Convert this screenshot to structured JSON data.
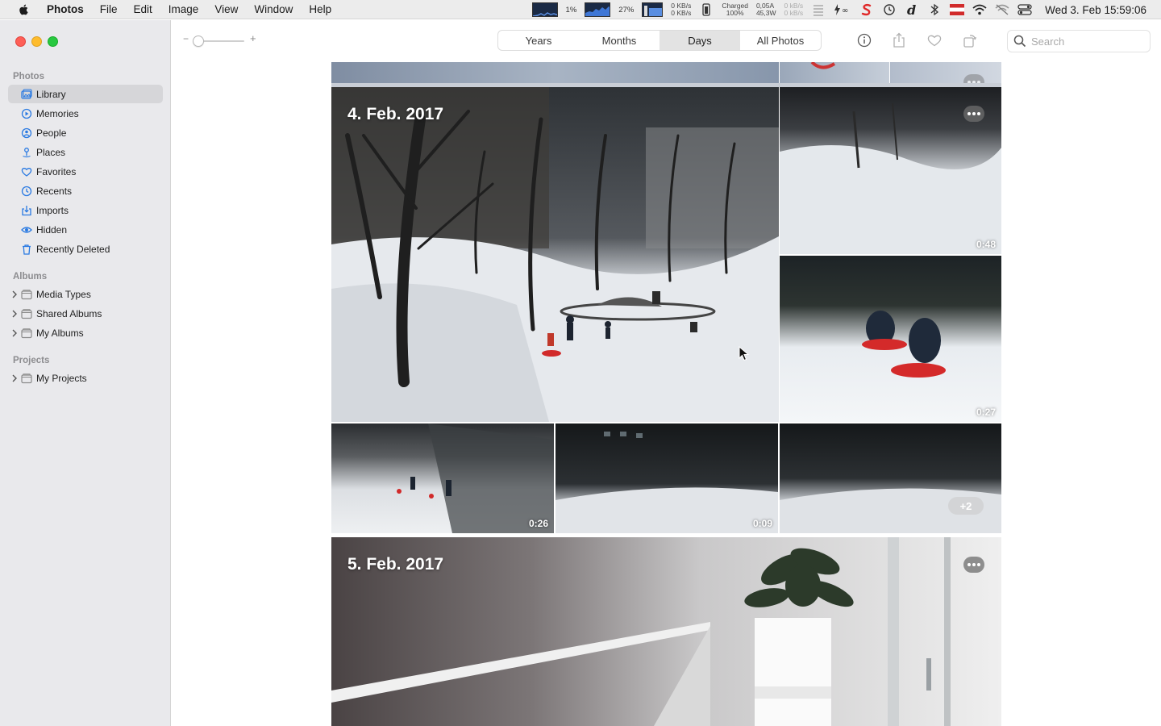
{
  "menubar": {
    "app_name": "Photos",
    "menus": [
      "File",
      "Edit",
      "Image",
      "View",
      "Window",
      "Help"
    ],
    "cpu_label": "1%",
    "gpu_label": "27%",
    "net_up": "0 KB/s",
    "net_down": "0 KB/s",
    "battery_status": "Charged",
    "battery_pct": "100%",
    "power_amp": "0,05A",
    "power_watt": "45,3W",
    "net2_up": "0 kB/s",
    "net2_down": "0 kB/s",
    "clock": "Wed 3. Feb  15:59:06"
  },
  "sidebar": {
    "section_photos": "Photos",
    "items": [
      {
        "label": "Library",
        "icon": "library-icon"
      },
      {
        "label": "Memories",
        "icon": "memories-icon"
      },
      {
        "label": "People",
        "icon": "people-icon"
      },
      {
        "label": "Places",
        "icon": "places-icon"
      },
      {
        "label": "Favorites",
        "icon": "heart-icon"
      },
      {
        "label": "Recents",
        "icon": "clock-icon"
      },
      {
        "label": "Imports",
        "icon": "import-icon"
      },
      {
        "label": "Hidden",
        "icon": "eye-icon"
      },
      {
        "label": "Recently Deleted",
        "icon": "trash-icon"
      }
    ],
    "section_albums": "Albums",
    "albums": [
      {
        "label": "Media Types"
      },
      {
        "label": "Shared Albums"
      },
      {
        "label": "My Albums"
      }
    ],
    "section_projects": "Projects",
    "projects": [
      {
        "label": "My Projects"
      }
    ]
  },
  "toolbar": {
    "zoom_minus": "−",
    "zoom_plus": "+",
    "segments": [
      "Years",
      "Months",
      "Days",
      "All Photos"
    ],
    "active_segment": "Days",
    "search_placeholder": "Search"
  },
  "days": [
    {
      "title": "4. Feb. 2017",
      "durations": [
        "0:48",
        "0:27",
        "0:26",
        "0:09"
      ],
      "extra_count": "+2"
    },
    {
      "title": "5. Feb. 2017"
    }
  ],
  "colors": {
    "accent": "#2a7ae2",
    "sidebar_bg": "#e9e9ec",
    "selected_bg": "#d6d6d9"
  }
}
